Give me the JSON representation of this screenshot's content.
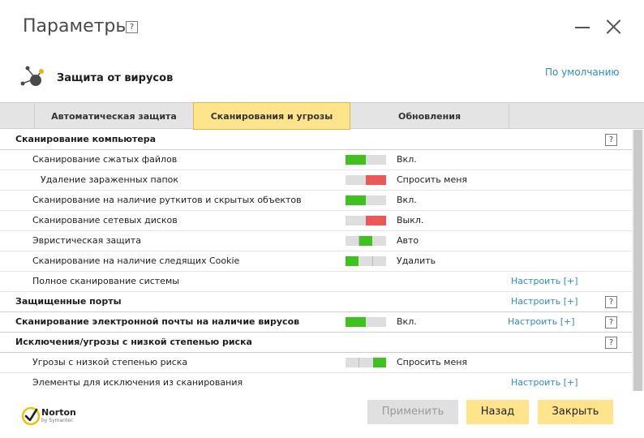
{
  "window": {
    "title": "Параметры",
    "help_label": "?"
  },
  "section": {
    "title": "Защита от вирусов",
    "defaults_link": "По умолчанию"
  },
  "tabs": [
    {
      "label": "Автоматическая защита",
      "active": false
    },
    {
      "label": "Сканирования и угрозы",
      "active": true
    },
    {
      "label": "Обновления",
      "active": false
    }
  ],
  "rows": [
    {
      "label": "Сканирование компьютера",
      "group": true,
      "help": "?"
    },
    {
      "label": "Сканирование сжатых файлов",
      "toggle": "on",
      "status": "Вкл."
    },
    {
      "label": "Удаление зараженных папок",
      "toggle": "ask",
      "status": "Спросить меня"
    },
    {
      "label": "Сканирование на наличие руткитов и скрытых объектов",
      "toggle": "on",
      "status": "Вкл."
    },
    {
      "label": "Сканирование сетевых дисков",
      "toggle": "off",
      "status": "Выкл."
    },
    {
      "label": "Эвристическая защита",
      "toggle": "auto",
      "status": "Авто"
    },
    {
      "label": "Сканирование на наличие следящих Cookie",
      "toggle": "delete",
      "status": "Удалить"
    },
    {
      "label": "Полное сканирование системы",
      "config": "Настроить [+]"
    },
    {
      "label": "Защищенные порты",
      "group": true,
      "config": "Настроить [+]",
      "help": "?"
    },
    {
      "label": "Сканирование электронной почты на наличие вирусов",
      "group": true,
      "toggle": "on",
      "status": "Вкл.",
      "config": "Настроить [+]",
      "help": "?"
    },
    {
      "label": "Исключения/угрозы с низкой степенью риска",
      "group": true,
      "help": "?"
    },
    {
      "label": "Угрозы с низкой степенью риска",
      "toggle": "ask3",
      "status": "Спросить меня"
    },
    {
      "label": "Элементы для исключения из сканирования",
      "config": "Настроить [+]"
    }
  ],
  "footer": {
    "brand": "Norton",
    "brand_sub": "by Symantec",
    "apply": "Применить",
    "back": "Назад",
    "close": "Закрыть"
  },
  "colors": {
    "accent": "#ffe48c",
    "link": "#2a8fc4",
    "on": "#3ec21e",
    "off": "#ec5757"
  }
}
